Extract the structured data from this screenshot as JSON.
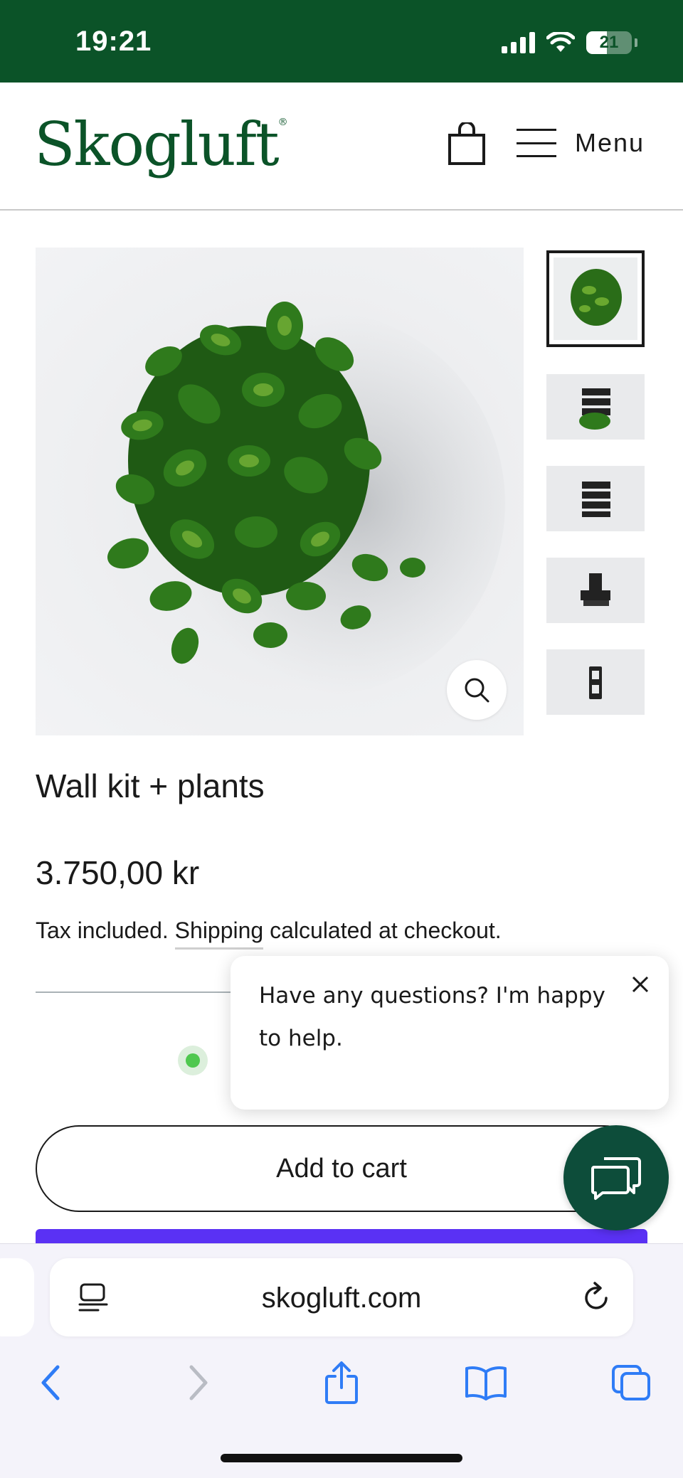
{
  "status_bar": {
    "time": "19:21",
    "battery": "21",
    "icons": [
      "signal-icon",
      "wifi-icon",
      "battery-icon"
    ]
  },
  "header": {
    "logo": "Skogluft",
    "logo_mark": "®",
    "cart_icon": "shopping-bag-icon",
    "menu_label": "Menu"
  },
  "gallery": {
    "main_image_alt": "wall-kit-with-plants",
    "zoom_icon": "search-icon",
    "thumbnail_count": 5,
    "active_thumbnail": 1
  },
  "product": {
    "title": "Wall kit + plants",
    "price": "3.750,00 kr",
    "tax_prefix": "Tax included.",
    "shipping_link": "Shipping",
    "tax_suffix": " calculated at checkout."
  },
  "chat": {
    "message": "Have any questions? I'm happy to help.",
    "close_icon": "close-icon",
    "launcher_icon": "chat-bubbles-icon"
  },
  "cart": {
    "add_to_cart": "Add to cart"
  },
  "browser": {
    "url": "skogluft.com",
    "nav_icons": [
      "back-icon",
      "forward-icon",
      "share-icon",
      "bookmarks-icon",
      "tabs-icon"
    ]
  },
  "colors": {
    "brand_green": "#0b5328",
    "chat_green": "#0d4d3a",
    "buy_now_purple": "#5a31f4",
    "stock_green": "#4fc84f",
    "safari_blue": "#2f7cf6"
  }
}
